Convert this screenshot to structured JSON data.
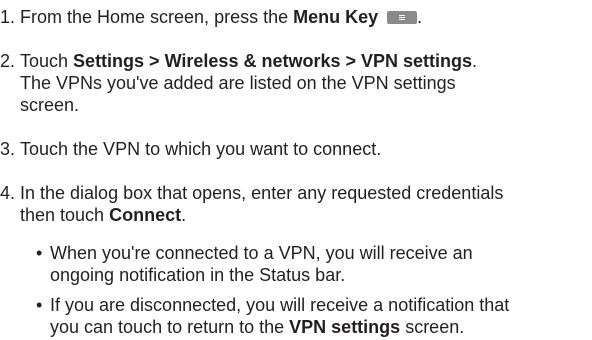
{
  "steps": [
    {
      "number": "1.",
      "t1": "From the Home screen, press the ",
      "b1": "Menu Key",
      "icon": "menu-key-icon",
      "t2": "."
    },
    {
      "number": "2.",
      "t1": "Touch ",
      "b1": "Settings > Wireless & networks > VPN settings",
      "t2": ".",
      "line2": "The VPNs you've added are listed on the VPN settings",
      "line3": "screen."
    },
    {
      "number": "3.",
      "t1": "Touch the VPN to which you want to connect."
    },
    {
      "number": "4.",
      "t1": "In the dialog box that opens, enter any requested credentials",
      "t2": "then touch ",
      "b1": "Connect",
      "t3": "."
    }
  ],
  "bullets": [
    {
      "dot": "•",
      "line1": "When you're connected to a VPN, you will receive an",
      "line2": "ongoing notification in the Status bar."
    },
    {
      "dot": "•",
      "line1": "If you are disconnected, you will receive a notification that",
      "t1": "you can touch to return to the ",
      "b1": "VPN settings",
      "t2": " screen."
    }
  ]
}
